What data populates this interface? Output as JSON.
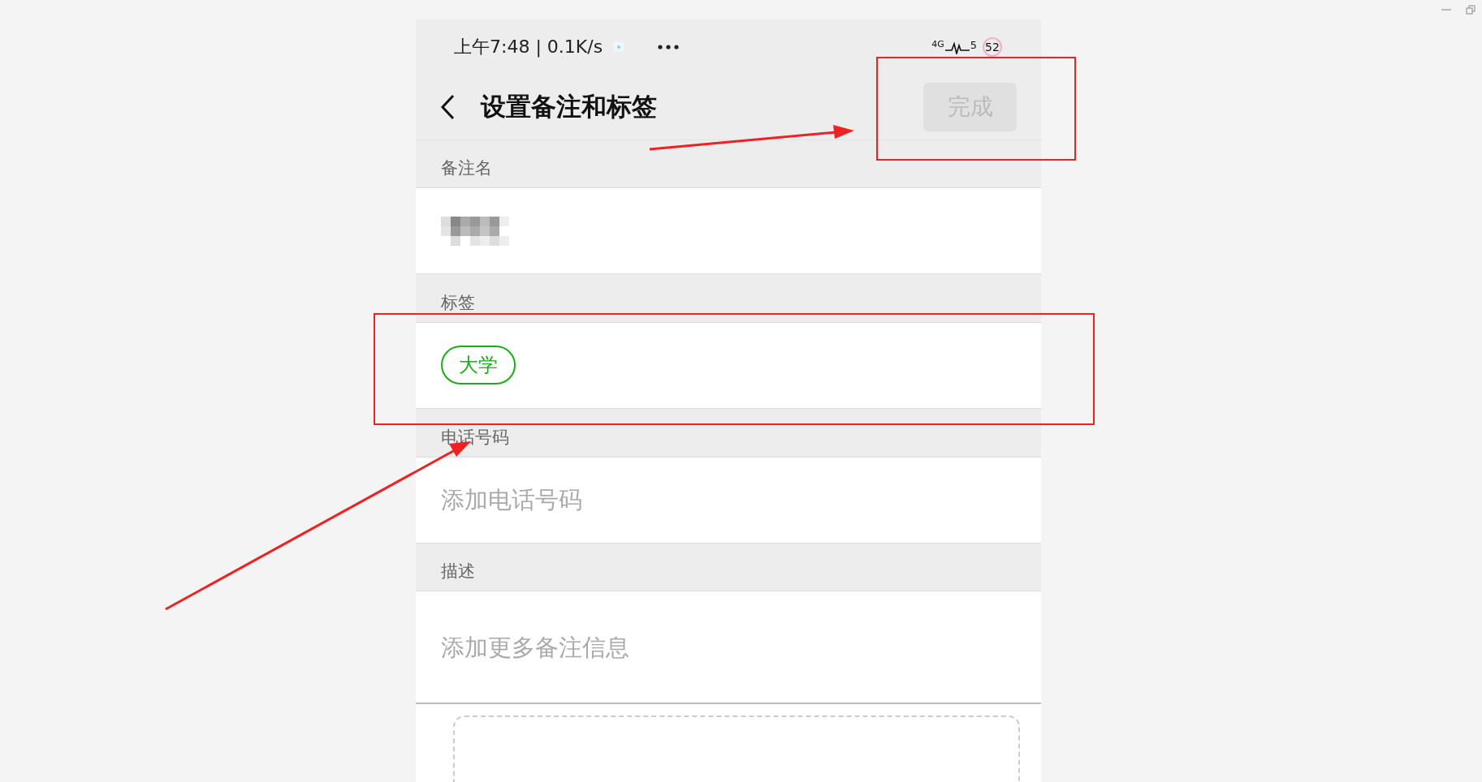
{
  "status_bar": {
    "time": "上午7:48 | 0.1K/s",
    "network": "4G",
    "signal_number": "5",
    "battery": "52"
  },
  "header": {
    "title": "设置备注和标签",
    "done_button": {
      "label": "完成",
      "disabled": true
    }
  },
  "sections": [
    {
      "label": "备注名",
      "kind": "redacted"
    },
    {
      "label": "标签",
      "kind": "tags",
      "tags": [
        {
          "label": "大学"
        }
      ]
    },
    {
      "label": "电话号码",
      "kind": "input",
      "placeholder": "添加电话号码"
    },
    {
      "label": "描述",
      "kind": "textarea",
      "placeholder": "添加更多备注信息"
    }
  ]
}
